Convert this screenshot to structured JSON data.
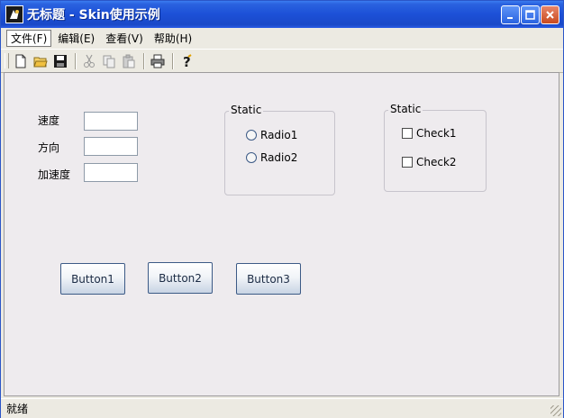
{
  "window": {
    "title": "无标题 - Skin使用示例"
  },
  "menu": [
    {
      "label": "文件(F)",
      "active": true
    },
    {
      "label": "编辑(E)"
    },
    {
      "label": "查看(V)"
    },
    {
      "label": "帮助(H)"
    }
  ],
  "toolbar": {
    "buttons": [
      "new-file-icon",
      "open-folder-icon",
      "save-icon",
      "cut-icon",
      "copy-icon",
      "paste-icon",
      "print-icon",
      "help-icon"
    ]
  },
  "form": {
    "speed_label": "速度",
    "direction_label": "方向",
    "acceleration_label": "加速度",
    "speed_value": "",
    "direction_value": "",
    "acceleration_value": ""
  },
  "radio_group": {
    "caption": "Static",
    "options": [
      "Radio1",
      "Radio2"
    ]
  },
  "check_group": {
    "caption": "Static",
    "options": [
      "Check1",
      "Check2"
    ]
  },
  "buttons": [
    "Button1",
    "Button2",
    "Button3"
  ],
  "status": {
    "text": "就绪"
  },
  "colors": {
    "titlebar": "#1c50d7",
    "client": "#eeebee",
    "button_border": "#3c5a86"
  }
}
